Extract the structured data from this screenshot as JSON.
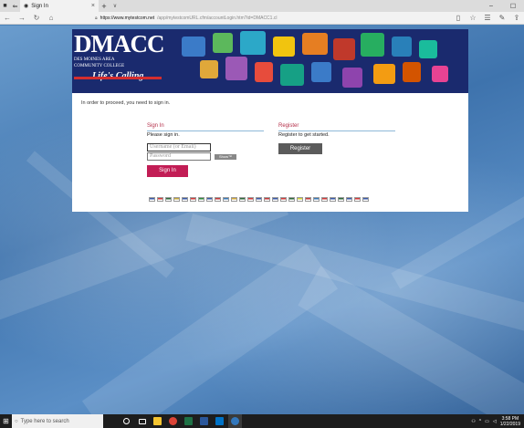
{
  "browser": {
    "tab_title": "Sign In",
    "tab_close": "×",
    "new_tab": "+",
    "tab_menu": "∨",
    "url_host": "https://www.mytestcom.net",
    "url_path": "/app/mytestcomURL.cfm/accountLogin.htm?id=DMACC1.cl",
    "controls": {
      "minimize": "–",
      "maximize": "☐",
      "close": "✕"
    }
  },
  "banner": {
    "logo_main": "DMACC",
    "logo_sub1": "DES MOINES AREA",
    "logo_sub2": "COMMUNITY COLLEGE",
    "logo_tag": "Life's Calling"
  },
  "page": {
    "intro": "In order to proceed, you need to sign in.",
    "signin": {
      "title": "Sign In",
      "subtitle": "Please sign in.",
      "username_placeholder": "Username (or Email)",
      "password_placeholder": "Password",
      "small_button": "Show™",
      "button": "Sign In"
    },
    "register": {
      "title": "Register",
      "subtitle": "Register to get started.",
      "button": "Register"
    },
    "flag_colors": [
      "#3a5aa8",
      "#d23a3a",
      "#2e6a3a",
      "#c4a83a",
      "#3a5aa8",
      "#d23a3a",
      "#2e8a3a",
      "#3a5aa8",
      "#c43a3a",
      "#3a7ab8",
      "#d2a83a",
      "#2e6a3a",
      "#d23a3a",
      "#3a5aa8",
      "#c43a3a",
      "#3a5aa8",
      "#d23a3a",
      "#2e6a3a",
      "#d2d23a",
      "#c43a3a",
      "#3a7ab8",
      "#d23a3a",
      "#3a5aa8",
      "#2e6a3a",
      "#3a5aa8",
      "#d23a3a",
      "#3a5aa8"
    ]
  },
  "taskbar": {
    "search_placeholder": "Type here to search",
    "time": "3:58 PM",
    "date": "1/22/2019"
  },
  "colors": {
    "banner_bg": "#1a2a6e",
    "accent": "#c21d55",
    "section_title": "#b5304a"
  }
}
